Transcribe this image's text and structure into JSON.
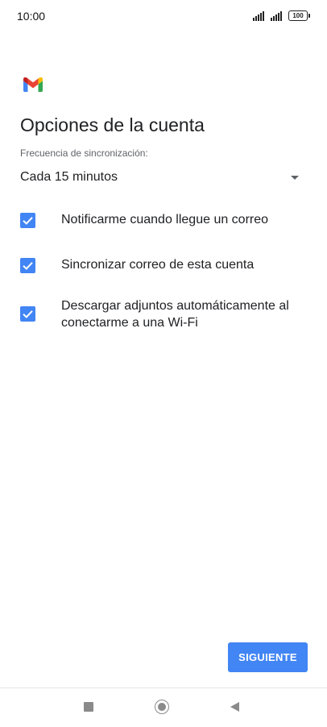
{
  "status_bar": {
    "time": "10:00",
    "battery": "100",
    "icons": [
      "signal-icon",
      "signal-icon",
      "battery-icon"
    ]
  },
  "app": {
    "logo_icon": "gmail-logo-icon"
  },
  "page": {
    "title": "Opciones de la cuenta"
  },
  "sync": {
    "label": "Frecuencia de sincronización:",
    "selected": "Cada 15 minutos",
    "icon": "dropdown-arrow-icon"
  },
  "options": [
    {
      "label": "Notificarme cuando llegue un correo",
      "checked": true
    },
    {
      "label": "Sincronizar correo de esta cuenta",
      "checked": true
    },
    {
      "label": "Descargar adjuntos automáticamente al conectarme a una Wi-Fi",
      "checked": true
    }
  ],
  "actions": {
    "next_label": "SIGUIENTE"
  },
  "nav": {
    "icons": [
      "recents-icon",
      "home-icon",
      "back-icon"
    ]
  },
  "colors": {
    "accent": "#4285f4",
    "text": "#202124",
    "secondary_text": "#5f6368"
  }
}
